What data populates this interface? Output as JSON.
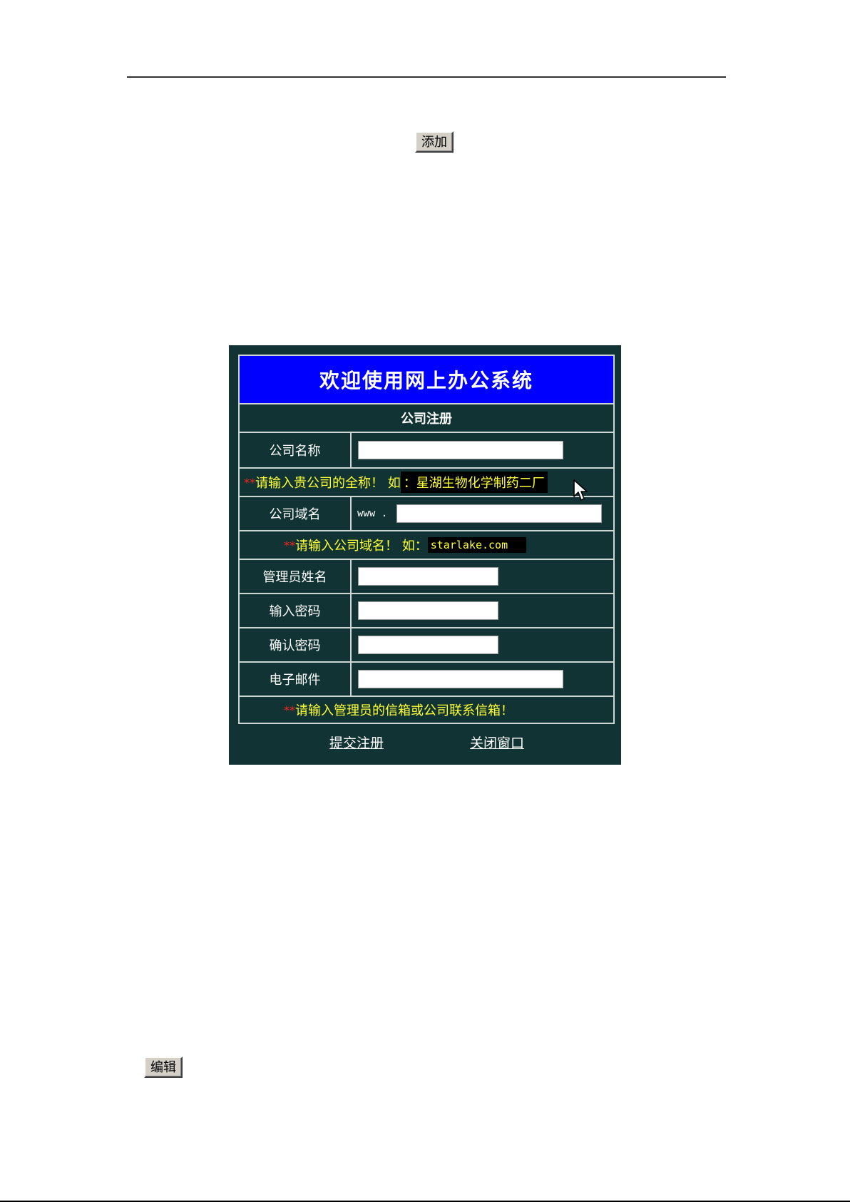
{
  "toolbar": {
    "add_label": "添加",
    "edit_label": "编辑"
  },
  "form": {
    "title": "欢迎使用网上办公系统",
    "subtitle": "公司注册",
    "company_name_label": "公司名称",
    "company_name_value": "",
    "hint_name_stars": "**",
    "hint_name_text": "请输入贵公司的全称！ 如 ",
    "hint_name_example": "：星湖生物化学制药二厂",
    "domain_label": "公司域名",
    "domain_prefix": "www .",
    "domain_value": "",
    "hint_domain_stars": "**",
    "hint_domain_text": "请输入公司域名！ 如：",
    "hint_domain_example": "starlake.com",
    "admin_label": "管理员姓名",
    "admin_value": "",
    "password_label": "输入密码",
    "password_value": "",
    "confirm_label": "确认密码",
    "confirm_value": "",
    "email_label": "电子邮件",
    "email_value": "",
    "hint_email_stars": "**",
    "hint_email_text": "请输入管理员的信箱或公司联系信箱！",
    "submit_label": "提交注册",
    "close_label": "关闭窗口"
  },
  "colors": {
    "panel_bg": "#113333",
    "title_bg": "#0000ff",
    "hint_text": "#ffff33",
    "hint_stars": "#ff2222"
  },
  "icons": {
    "cursor": "mouse-pointer-icon"
  }
}
